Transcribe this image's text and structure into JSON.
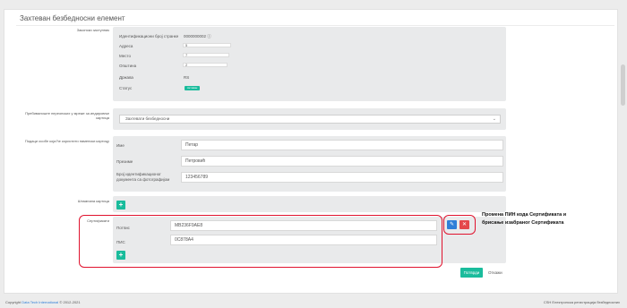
{
  "page": {
    "title": "Захтеван безбедносни елемент"
  },
  "holder": {
    "label": "Законски заступник",
    "id_row": {
      "key": "Идентификациони број странке",
      "value": "0000000002 ⓘ"
    },
    "rows": [
      {
        "key": "Адреса",
        "value": "5"
      },
      {
        "key": "Место",
        "value": "7"
      },
      {
        "key": "Општина",
        "value": "2"
      },
      {
        "key": "Држава",
        "value": "RS"
      }
    ],
    "status": {
      "key": "Статус",
      "value": "Активан"
    }
  },
  "delivery": {
    "label": "Пребивалиште нереонских у мреже за индировње картица",
    "selected": "Захтевати безбедносни"
  },
  "card_person": {
    "label": "Подаци особе која ће користити наменски картицу",
    "fields": [
      {
        "key": "Име",
        "value": "Петар"
      },
      {
        "key": "Презиме",
        "value": "Петровић"
      },
      {
        "key": "Број идентификационог документа са фотографијом",
        "value": "123456789"
      }
    ]
  },
  "printed_card": {
    "label": "Штампана картица"
  },
  "certificates": {
    "label": "Сертификати",
    "fields": [
      {
        "key": "Потпис",
        "value": "MB236F9AE8"
      },
      {
        "key": "ПИС",
        "value": "0C878A4"
      }
    ],
    "annotation": "Промена ПИН кода Сертификата и брисање изабраног Сертификата"
  },
  "actions": {
    "save": "Потврди",
    "cancel": "Откажи"
  },
  "footer": {
    "prefix": "Copyright ",
    "brand": "Data Tech International",
    "years": " © 2012-2021",
    "right": "CSH Електронска регистрација безбедносних"
  },
  "colors": {
    "accent": "#1abc9c",
    "highlight": "#e0132e",
    "edit": "#2f7fd8",
    "delete": "#e4484b"
  }
}
